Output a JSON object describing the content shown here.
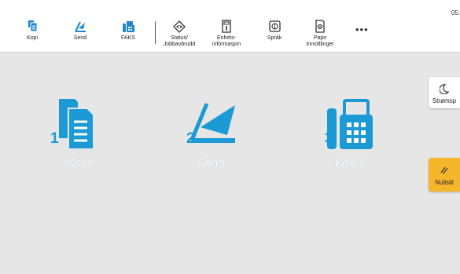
{
  "status_bar": {
    "time": "05:"
  },
  "toolbar": {
    "items": [
      {
        "label": "Kopi",
        "icon": "copy-icon"
      },
      {
        "label": "Send",
        "icon": "send-icon"
      },
      {
        "label": "FAKS",
        "icon": "fax-icon"
      },
      {
        "label": "Status/\nJobbavbrudd",
        "icon": "status-icon"
      },
      {
        "label": "Enhets-\ninformasjon",
        "icon": "device-info-icon"
      },
      {
        "label": "Språk",
        "icon": "language-icon"
      },
      {
        "label": "Papir\nInnstillinger",
        "icon": "paper-settings-icon"
      }
    ],
    "more": "•••"
  },
  "apps": [
    {
      "label": "Kopi",
      "number": "1",
      "icon": "copy-icon"
    },
    {
      "label": "Send",
      "number": "2",
      "icon": "send-icon"
    },
    {
      "label": "FAKS",
      "number": "3",
      "icon": "fax-icon"
    }
  ],
  "side_buttons": {
    "power": {
      "label": "Strømsp",
      "icon": "moon-icon"
    },
    "reset": {
      "label": "Nullstil",
      "icon": "reset-icon"
    }
  },
  "colors": {
    "accent": "#1b9ad6",
    "toolbar_icon": "#1e88c8",
    "reset_bg": "#f6b62b",
    "background": "#e6e6e6"
  }
}
